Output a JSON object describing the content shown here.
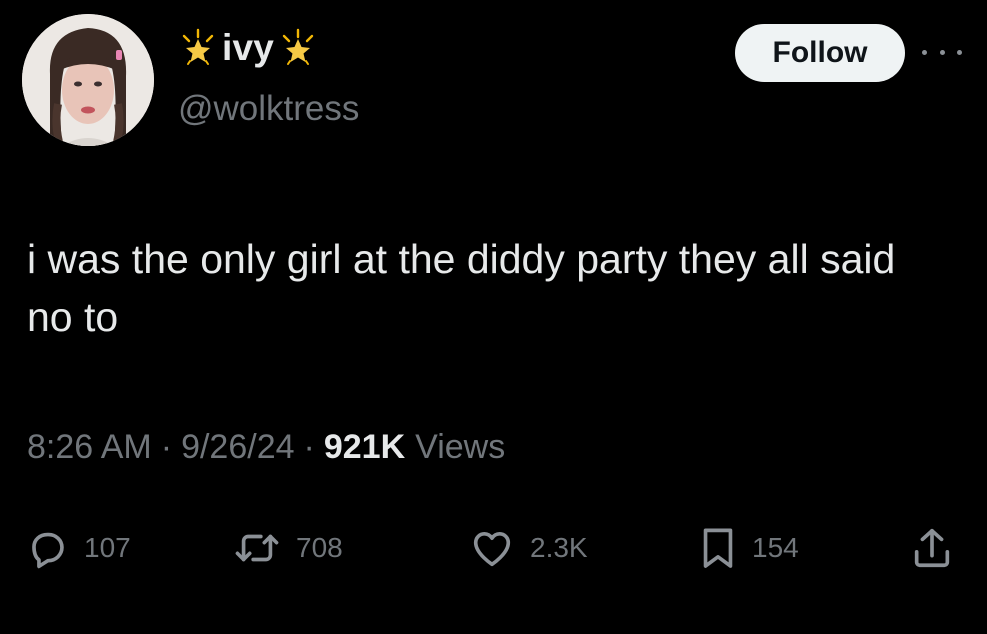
{
  "author": {
    "display_name": "ivy",
    "handle": "@wolktress",
    "name_decoration_icon": "sparkle-icon"
  },
  "follow_label": "Follow",
  "tweet": {
    "text": "i was the only girl at the diddy party they all said no to"
  },
  "meta": {
    "time": "8:26 AM",
    "separator": "·",
    "date": "9/26/24",
    "views_count": "921K",
    "views_label": "Views"
  },
  "actions": {
    "replies": "107",
    "reposts": "708",
    "likes": "2.3K",
    "bookmarks": "154"
  },
  "colors": {
    "background": "#000000",
    "primary_text": "#e7e9ea",
    "secondary_text": "#71767b",
    "follow_button_bg": "#eff3f4"
  }
}
